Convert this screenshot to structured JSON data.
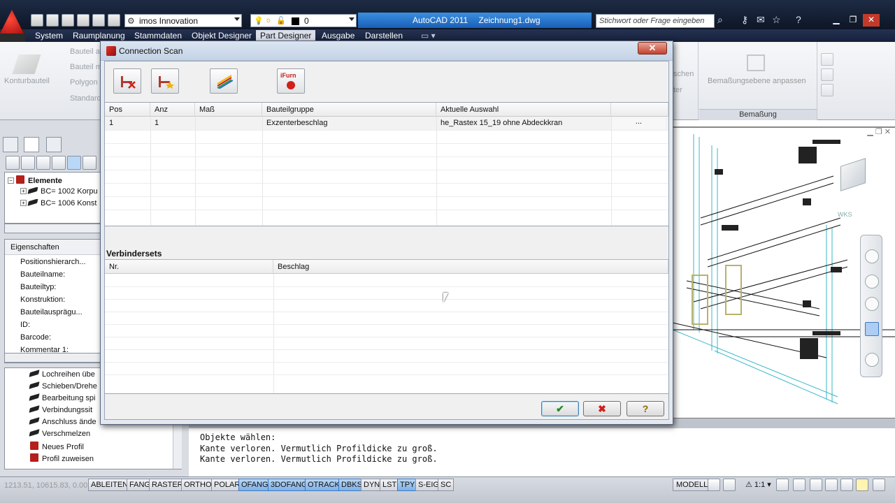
{
  "titlebar": {
    "workspace": "imos Innovation",
    "layer": "0",
    "app": "AutoCAD 2011",
    "file": "Zeichnung1.dwg",
    "search_placeholder": "Stichwort oder Frage eingeben",
    "accent": "#2f7fd6"
  },
  "menubar": {
    "items": [
      "System",
      "Raumplanung",
      "Stammdaten",
      "Objekt Designer",
      "Part Designer",
      "Ausgabe",
      "Darstellen"
    ],
    "active": "Part Designer"
  },
  "ribbon": {
    "kontur": "Konturbauteil",
    "bauteil_a": "Bauteil a",
    "bauteil_m": "Bauteil m",
    "polygon": "Polygon",
    "standard": "Standard",
    "schen": "schen",
    "ter": "ter",
    "bem_anpassen": "Bemaßungsebene anpassen",
    "group_bemassung": "Bemaßung"
  },
  "left_panel": {
    "tree": {
      "root": "Elemente",
      "children": [
        "BC= 1002 Korpu",
        "BC= 1006 Konst"
      ]
    },
    "properties": {
      "header": "Eigenschaften",
      "rows": [
        "Positionshierarch...",
        "Bauteilname:",
        "Bauteiltyp:",
        "Konstruktion:",
        "Bauteilausprägu...",
        "ID:",
        "Barcode:",
        "Kommentar 1:"
      ]
    },
    "commands": [
      "Lochreihen übe",
      "Schieben/Drehe",
      "Bearbeitung spi",
      "Verbindungssit",
      "Anschluss ände",
      "Verschmelzen",
      "Neues Profil",
      "Profil zuweisen"
    ]
  },
  "dialog": {
    "title": "Connection Scan",
    "close": "✕",
    "toolbar_icons": [
      "delete-connection-icon",
      "favorite-connection-icon",
      "layers-icon",
      "ifurn-icon"
    ],
    "ifurn_label": "iFurn",
    "grid1": {
      "headers": [
        "Pos",
        "Anz",
        "Maß",
        "Bauteilgruppe",
        "Aktuelle Auswahl"
      ],
      "rows": [
        {
          "pos": "1",
          "anz": "1",
          "mass": "",
          "gruppe": "Exzenterbeschlag",
          "auswahl": "he_Rastex 15_19 ohne Abdeckkran",
          "action": "..."
        }
      ]
    },
    "sets_label": "Verbindersets",
    "grid2": {
      "headers": [
        "Nr.",
        "Beschlag"
      ]
    },
    "buttons": {
      "ok": "✔",
      "cancel": "✖",
      "help": "?"
    }
  },
  "drawing": {
    "wks": "WKS"
  },
  "cmdline": {
    "lines": [
      "Objekte wählen:",
      "Kante verloren. Vermutlich Profildicke zu groß.",
      "Kante verloren. Vermutlich Profildicke zu groß."
    ]
  },
  "statusbar": {
    "coords": "1213.51, 10615.83, 0.00",
    "toggles": [
      {
        "label": "ABLEITEN",
        "on": false
      },
      {
        "label": "FANG",
        "on": false
      },
      {
        "label": "RASTER",
        "on": false
      },
      {
        "label": "ORTHO",
        "on": false
      },
      {
        "label": "POLAR",
        "on": false
      },
      {
        "label": "OFANG",
        "on": true
      },
      {
        "label": "3DOFANG",
        "on": true
      },
      {
        "label": "OTRACK",
        "on": true
      },
      {
        "label": "DBKS",
        "on": true
      },
      {
        "label": "DYN",
        "on": false
      },
      {
        "label": "LST",
        "on": false
      },
      {
        "label": "TPY",
        "on": true
      },
      {
        "label": "S-EIG",
        "on": false
      },
      {
        "label": "SC",
        "on": false
      }
    ],
    "model": "MODELL",
    "scale": "1:1"
  }
}
